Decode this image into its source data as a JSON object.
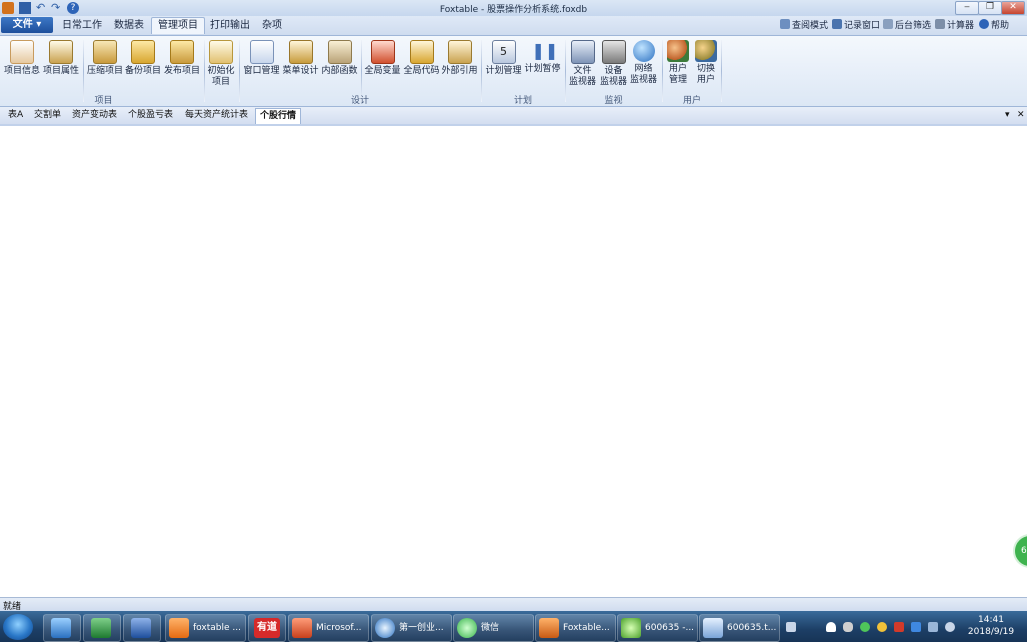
{
  "window": {
    "title": "Foxtable - 股票操作分析系统.foxdb",
    "minimize": "‒",
    "restore": "❐",
    "close": "✕"
  },
  "quick_access": [
    "save-icon",
    "undo-icon",
    "redo-icon",
    "help-icon"
  ],
  "ribbon_tabs": {
    "file": "文件",
    "items": [
      "日常工作",
      "数据表",
      "管理项目",
      "打印输出",
      "杂项"
    ],
    "active": "管理项目"
  },
  "ribbon_right": [
    "查阅模式",
    "记录窗口",
    "后台筛选",
    "计算器",
    "帮助"
  ],
  "ribbon_groups": [
    {
      "label": "项目",
      "buttons": [
        "项目信息",
        "项目属性",
        "压缩项目",
        "备份项目",
        "发布项目"
      ]
    },
    {
      "label": "",
      "buttons": [
        "初始化\n项目"
      ]
    },
    {
      "label": "设计",
      "buttons": [
        "窗口管理",
        "菜单设计",
        "内部函数",
        "全局变量",
        "全局代码",
        "外部引用"
      ]
    },
    {
      "label": "计划",
      "buttons": [
        "计划管理",
        "计划暂停"
      ]
    },
    {
      "label": "监视",
      "buttons": [
        "文件\n监视器",
        "设备\n监视器",
        "网络\n监视器"
      ]
    },
    {
      "label": "用户",
      "buttons": [
        "用户\n管理",
        "切换\n用户"
      ]
    }
  ],
  "doc_tabs": {
    "items": [
      "表A",
      "交割单",
      "资产变动表",
      "个股盈亏表",
      "每天资产统计表",
      "个股行情"
    ],
    "active": "个股行情",
    "dropdown": "▾",
    "close": "✕"
  },
  "status": "就绪",
  "badge": "68",
  "taskbar": {
    "items": [
      "foxtable ...",
      "有道",
      "Microsof...",
      "第一创业...",
      "微信",
      "Foxtable...",
      "600635 -...",
      "600635.t..."
    ],
    "pinned": [
      "explorer-icon",
      "excel-icon",
      "word-icon"
    ],
    "clock_time": "14:41",
    "clock_date": "2018/9/19"
  },
  "colors": {
    "accent": "#1d4f9c",
    "ribbon_bg": "#dce7f5",
    "taskbar": "#1d3f66"
  }
}
